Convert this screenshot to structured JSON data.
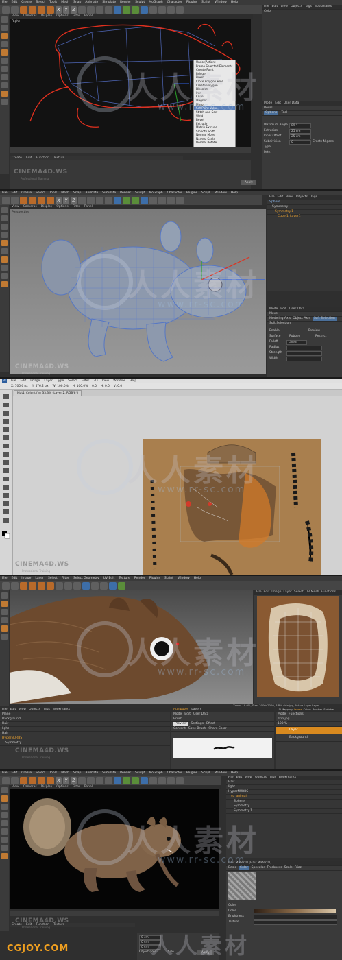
{
  "panel1": {
    "menu": [
      "File",
      "Edit",
      "Create",
      "Select",
      "Tools",
      "Mesh",
      "Snap",
      "Animate",
      "Simulate",
      "Render",
      "Sculpt",
      "MoGraph",
      "Character",
      "Plugins",
      "Script",
      "Window",
      "Help"
    ],
    "xyz": [
      "X",
      "Y",
      "Z"
    ],
    "viewport_menu": [
      "View",
      "Cameras",
      "Display",
      "Options",
      "Filter",
      "Panel"
    ],
    "viewport_label": "Right",
    "context_menu": [
      "Undo (Action)",
      "Frame Selected Elements",
      "Create Point",
      "Bridge",
      "Brush",
      "Close Polygon Hole",
      "Create Polygon",
      "Dissolve",
      "Iron",
      "Knife",
      "Magnet",
      "Mirror",
      "Set Point Value",
      "Stitch and Sew",
      "Weld",
      "Bevel",
      "Extrude",
      "Matrix Extrude",
      "Smooth Shift",
      "Normal Move",
      "Normal Scale",
      "Normal Rotate"
    ],
    "context_selected": "Set Point Value",
    "right_menu": [
      "File",
      "Edit",
      "View",
      "Objects",
      "Tags",
      "Bookmarks"
    ],
    "right_tree": [
      "Color"
    ],
    "attr_menu": [
      "Mode",
      "Edit",
      "User Data"
    ],
    "attr_title": "Bevel",
    "attr_tabs": [
      "Options",
      "Tool"
    ],
    "attr_fields": [
      "Maximum Angle",
      "Extrusion",
      "Inner Offset",
      "Subdivision",
      "Type",
      "Path"
    ],
    "attr_values": [
      "89 °",
      "25 cm",
      "25 cm",
      "0"
    ],
    "attr_extra": [
      "Create N-gons"
    ],
    "material_menu": [
      "Create",
      "Edit",
      "Function",
      "Texture"
    ],
    "apply": "Apply",
    "cinema4d": "CINEMA4D.WS",
    "cinema4d_sub": "Professional Training"
  },
  "panel2": {
    "menu": [
      "File",
      "Edit",
      "Create",
      "Select",
      "Tools",
      "Mesh",
      "Snap",
      "Animate",
      "Simulate",
      "Render",
      "Sculpt",
      "MoGraph",
      "Character",
      "Plugins",
      "Script",
      "Window",
      "Help"
    ],
    "xyz": [
      "X",
      "Y",
      "Z"
    ],
    "viewport_menu": [
      "View",
      "Cameras",
      "Display",
      "Options",
      "Filter",
      "Panel"
    ],
    "viewport_label": "Perspective",
    "right_menu": [
      "File",
      "Edit",
      "View",
      "Objects",
      "Tags"
    ],
    "right_tree": [
      "Sphere",
      "Symmetry",
      "Symmetry.1",
      "Cube.1_Layer1"
    ],
    "attr_menu": [
      "Mode",
      "Edit",
      "User Data"
    ],
    "attr_title": "Move",
    "attr_tabs": [
      "Modeling Axis",
      "Object Axis",
      "Soft Selection"
    ],
    "attr_section": "Soft Selection",
    "attr_fields": [
      "Enable",
      "Surface",
      "Falloff",
      "Radius",
      "Strength",
      "Width"
    ],
    "attr_extra": [
      "Preview",
      "Rubber",
      "Restrict",
      "Linear"
    ],
    "cinema4d": "CINEMA4D.WS",
    "cinema4d_sub": "Professional Training"
  },
  "panel3": {
    "app_menu": [
      "Ps",
      "File",
      "Edit",
      "Image",
      "Layer",
      "Type",
      "Select",
      "Filter",
      "3D",
      "View",
      "Window",
      "Help"
    ],
    "options": [
      "X: 705.6 px",
      "Y: 576.2 px",
      "W: 100.0%",
      "H: 100.0%",
      "0.0",
      "H: 0.0",
      "V: 0.0"
    ],
    "tab": "Mat1_Color.tif @ 33.3% (Layer 2, RGB/8*)",
    "cinema4d": "CINEMA4D.WS",
    "cinema4d_sub": "Professional Training"
  },
  "panel4": {
    "menu": [
      "File",
      "Edit",
      "Image",
      "Layer",
      "Select",
      "Filter",
      "Select Geometry",
      "UV Edit",
      "Texture",
      "Render",
      "Plugins",
      "Script",
      "Window",
      "Help"
    ],
    "texture_menu": [
      "File",
      "Edit",
      "Image",
      "Layer",
      "Select",
      "UV Mesh",
      "Functions"
    ],
    "status": "Zoom: 19.0%, Size: 2000x2000, 8 Bit, skin.jpg, Active Layer Layer",
    "objects_menu": [
      "File",
      "Edit",
      "View",
      "Objects",
      "Tags",
      "Bookmarks"
    ],
    "objects": [
      "Plane",
      "Background",
      "Hair",
      "light",
      "Hair",
      "HyperNURBS",
      "Symmetry"
    ],
    "attr_tabs": [
      "Attributes",
      "Layers"
    ],
    "attr_menu": [
      "Mode",
      "Edit",
      "User Data"
    ],
    "attr_title": "Brush",
    "brush_tabs": [
      "Preview",
      "Settings",
      "Effect"
    ],
    "brush_buttons": [
      "Content",
      "Save Brush",
      "Share Color"
    ],
    "layers_tabs": [
      "UV Mapping",
      "Layers",
      "Colors",
      "Brushes",
      "Switches"
    ],
    "layers_menu": [
      "Mode",
      "Functions"
    ],
    "layers_file": "skin.jpg",
    "layers": [
      "Layer",
      "Background"
    ],
    "zoom": "100 %",
    "cinema4d": "CINEMA4D.WS",
    "cinema4d_sub": "Professional Training"
  },
  "panel5": {
    "menu": [
      "File",
      "Edit",
      "Create",
      "Select",
      "Tools",
      "Mesh",
      "Snap",
      "Animate",
      "Simulate",
      "Render",
      "Sculpt",
      "MoGraph",
      "Character",
      "Plugins",
      "Script",
      "Window",
      "Help"
    ],
    "xyz": [
      "X",
      "Y",
      "Z"
    ],
    "viewport_menu": [
      "View",
      "Cameras",
      "Display",
      "Options",
      "Filter",
      "Panel"
    ],
    "right_menu": [
      "File",
      "Edit",
      "View",
      "Objects",
      "Tags",
      "Bookmarks"
    ],
    "right_tree": [
      "Hair",
      "light",
      "HyperNURBS",
      "sq_animal",
      "Sphere",
      "Symmetry",
      "Symmetry.1"
    ],
    "material_tabs": [
      "Basic",
      "Color",
      "Specular",
      "Thickness",
      "Scale",
      "Frizz"
    ],
    "material_title": "Hair Material [Hair Material]",
    "material_section": "Color",
    "material_fields": [
      "Color",
      "Brightness",
      "Texture"
    ],
    "bottom_menu": [
      "Create",
      "Edit",
      "Function",
      "Texture"
    ],
    "bottom_bar": [
      "Object (Rel)",
      "Size"
    ],
    "bottom_fields": [
      "0 cm",
      "0 cm",
      "0 cm"
    ],
    "apply": "Apply",
    "cinema4d": "CINEMA4D.WS",
    "cinema4d_sub": "Professional Training"
  },
  "watermarks": {
    "cn": "人人素材",
    "url": "www.rr-sc.com",
    "site": "CGJOY.COM"
  },
  "colors": {
    "accent_orange": "#d98a1f",
    "spline_red": "#e0301e",
    "mesh_blue": "#6f8fd0",
    "selection_blue": "#5a7fb8"
  }
}
